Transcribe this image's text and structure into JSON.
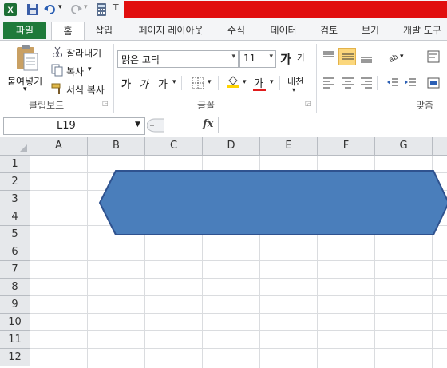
{
  "quick_access": {
    "app_icon": "excel-icon",
    "save_icon": "save-icon",
    "undo_icon": "undo-icon",
    "redo_icon": "redo-icon",
    "calc_icon": "calculator-icon",
    "customize_icon": "customize-qat-icon"
  },
  "tabs": [
    {
      "label": "파일"
    },
    {
      "label": "홈"
    },
    {
      "label": "삽입"
    },
    {
      "label": "페이지 레이아웃"
    },
    {
      "label": "수식"
    },
    {
      "label": "데이터"
    },
    {
      "label": "검토"
    },
    {
      "label": "보기"
    },
    {
      "label": "개발 도구"
    }
  ],
  "clipboard": {
    "paste_label": "붙여넣기",
    "cut_label": "잘라내기",
    "copy_label": "복사",
    "format_painter_label": "서식 복사",
    "group_label": "클립보드"
  },
  "font": {
    "name": "맑은 고딕",
    "size": "11",
    "grow_label": "가",
    "shrink_label": "가",
    "bold_label": "가",
    "italic_label": "가",
    "underline_label": "가",
    "font_color_label": "가",
    "phonetic_label": "내천",
    "group_label": "글꼴"
  },
  "alignment": {
    "group_label": "맞춤"
  },
  "formula_bar": {
    "name_box": "L19",
    "fx_label": "fx",
    "formula": ""
  },
  "columns": [
    "A",
    "B",
    "C",
    "D",
    "E",
    "F",
    "G"
  ],
  "rows": [
    "1",
    "2",
    "3",
    "4",
    "5",
    "6",
    "7",
    "8",
    "9",
    "10",
    "11",
    "12"
  ],
  "shape": {
    "type": "hexagon",
    "fill": "#4a7ebb",
    "stroke": "#2f528f"
  },
  "colors": {
    "file_tab": "#1f7a3a",
    "title_bar": "#e10e0e",
    "header_bg": "#e6e8eb"
  }
}
